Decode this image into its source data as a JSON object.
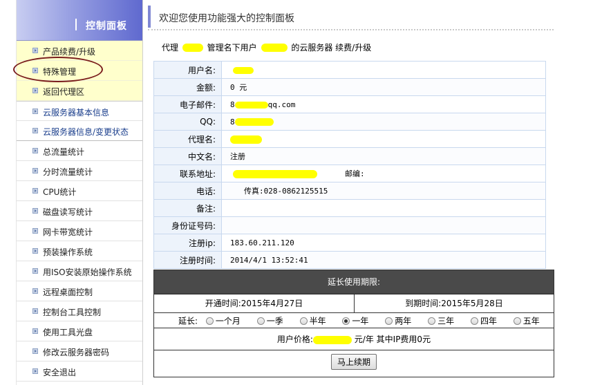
{
  "sidebar": {
    "title": "控制面板",
    "items": [
      {
        "label": "产品续费/升级"
      },
      {
        "label": "特殊管理"
      },
      {
        "label": "返回代理区"
      },
      {
        "label": "云服务器基本信息"
      },
      {
        "label": "云服务器信息/变更状态"
      },
      {
        "label": "总流量统计"
      },
      {
        "label": "分时流量统计"
      },
      {
        "label": "CPU统计"
      },
      {
        "label": "磁盘读写统计"
      },
      {
        "label": "网卡带宽统计"
      },
      {
        "label": "预装操作系统"
      },
      {
        "label": "用ISO安装原始操作系统"
      },
      {
        "label": "远程桌面控制"
      },
      {
        "label": "控制台工具控制"
      },
      {
        "label": "使用工具光盘"
      },
      {
        "label": "修改云服务器密码"
      },
      {
        "label": "安全退出"
      }
    ]
  },
  "main": {
    "title": "欢迎您使用功能强大的控制面板",
    "subhead": {
      "p1": "代理",
      "p2": "管理名下用户",
      "p3": "的云服务器 续费/升级"
    },
    "info": {
      "username_label": "用户名:",
      "amount_label": "金额:",
      "amount_value": "0 元",
      "email_label": "电子邮件:",
      "email_prefix": "8",
      "email_suffix": "qq.com",
      "qq_label": "QQ:",
      "qq_prefix": "8",
      "agent_label": "代理名:",
      "cname_label": "中文名:",
      "cname_value": "注册",
      "address_label": "联系地址:",
      "postcode_label": "邮编:",
      "phone_label": "电话:",
      "fax_label": "传真:",
      "fax_value": "028-0862125515",
      "note_label": "备注:",
      "idcard_label": "身份证号码:",
      "regip_label": "注册ip:",
      "regip_value": "183.60.211.120",
      "regtime_label": "注册时间:",
      "regtime_value": "2014/4/1 13:52:41"
    },
    "extend": {
      "header": "延长使用期限:",
      "open_label": "开通时间:",
      "open_value": "2015年4月27日",
      "expire_label": "到期时间:",
      "expire_value": "2015年5月28日",
      "period_label": "延长:",
      "options": [
        "一个月",
        "一季",
        "半年",
        "一年",
        "两年",
        "三年",
        "四年",
        "五年"
      ],
      "selected": "一年",
      "price_label": "用户价格:",
      "price_unit_tail": "元/年",
      "price_note": "其中IP费用0元",
      "renew_button": "马上续期"
    }
  },
  "colors": {
    "redaction": "#ffff00",
    "sidebar_header": "#5f69cf",
    "extend_header": "#4a4a4a",
    "annotation": "#7a1d1d"
  }
}
